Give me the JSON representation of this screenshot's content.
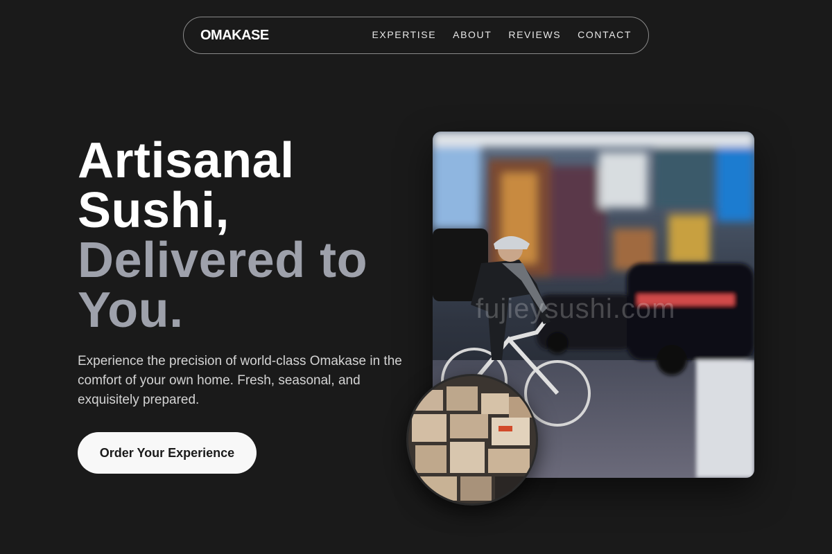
{
  "nav": {
    "logo": "OMAKASE",
    "links": [
      "EXPERTISE",
      "ABOUT",
      "REVIEWS",
      "CONTACT"
    ]
  },
  "hero": {
    "title_lines": [
      "Artisanal",
      "Sushi,",
      "Delivered to",
      "You."
    ],
    "subtitle": "Experience the precision of world-class Omakase in the comfort of your own home. Fresh, seasonal, and exquisitely prepared.",
    "cta_label": "Order Your Experience"
  },
  "images": {
    "main_watermark": "fujieysushi.com",
    "main_subject": "delivery-cyclist-city-street",
    "inset_subject": "stacked-delivery-boxes"
  },
  "colors": {
    "background": "#1a1a1a",
    "title_primary": "#ffffff",
    "title_muted": "#9ea1ab",
    "cta_bg": "#f8f8f8"
  }
}
